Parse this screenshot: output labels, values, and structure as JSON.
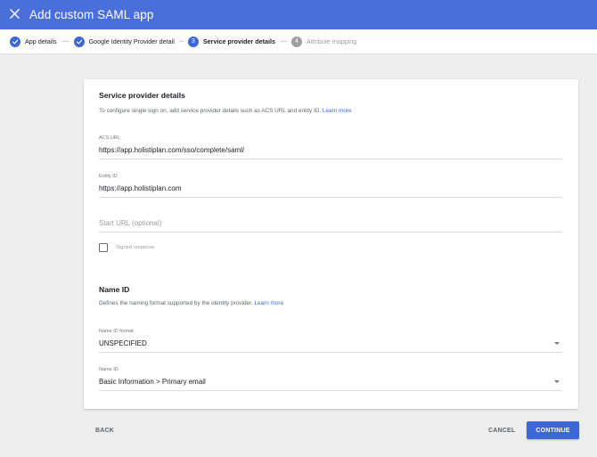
{
  "header": {
    "title": "Add custom SAML app",
    "bg_color": "#4a6fdb",
    "close_icon": "close-icon"
  },
  "stepper": {
    "steps": [
      {
        "number": "1",
        "label": "App details",
        "state": "done"
      },
      {
        "number": "2",
        "label": "Google Identity Provider detail",
        "state": "done"
      },
      {
        "number": "3",
        "label": "Service provider details",
        "state": "active"
      },
      {
        "number": "4",
        "label": "Attribute mapping",
        "state": "pending"
      }
    ]
  },
  "service_provider": {
    "title": "Service provider details",
    "description": "To configure single sign on, add service provider details such as ACS URL and entity ID.",
    "learn_more": "Learn more",
    "acs_url": {
      "label": "ACS URL",
      "value": "https://app.holistiplan.com/sso/complete/saml/"
    },
    "entity_id": {
      "label": "Entity ID",
      "value": "https://app.holistiplan.com"
    },
    "start_url": {
      "placeholder": "Start URL (optional)",
      "value": ""
    },
    "signed_response": {
      "label": "Signed response",
      "checked": false
    }
  },
  "name_id": {
    "title": "Name ID",
    "description": "Defines the naming format supported by the identity provider.",
    "learn_more": "Learn more",
    "format": {
      "label": "Name ID format",
      "value": "UNSPECIFIED"
    },
    "name_id": {
      "label": "Name ID",
      "value": "Basic Information > Primary email"
    }
  },
  "footer": {
    "back": "BACK",
    "cancel": "CANCEL",
    "continue": "CONTINUE"
  },
  "colors": {
    "accent": "#3c67d6",
    "background": "#eeeeee"
  }
}
